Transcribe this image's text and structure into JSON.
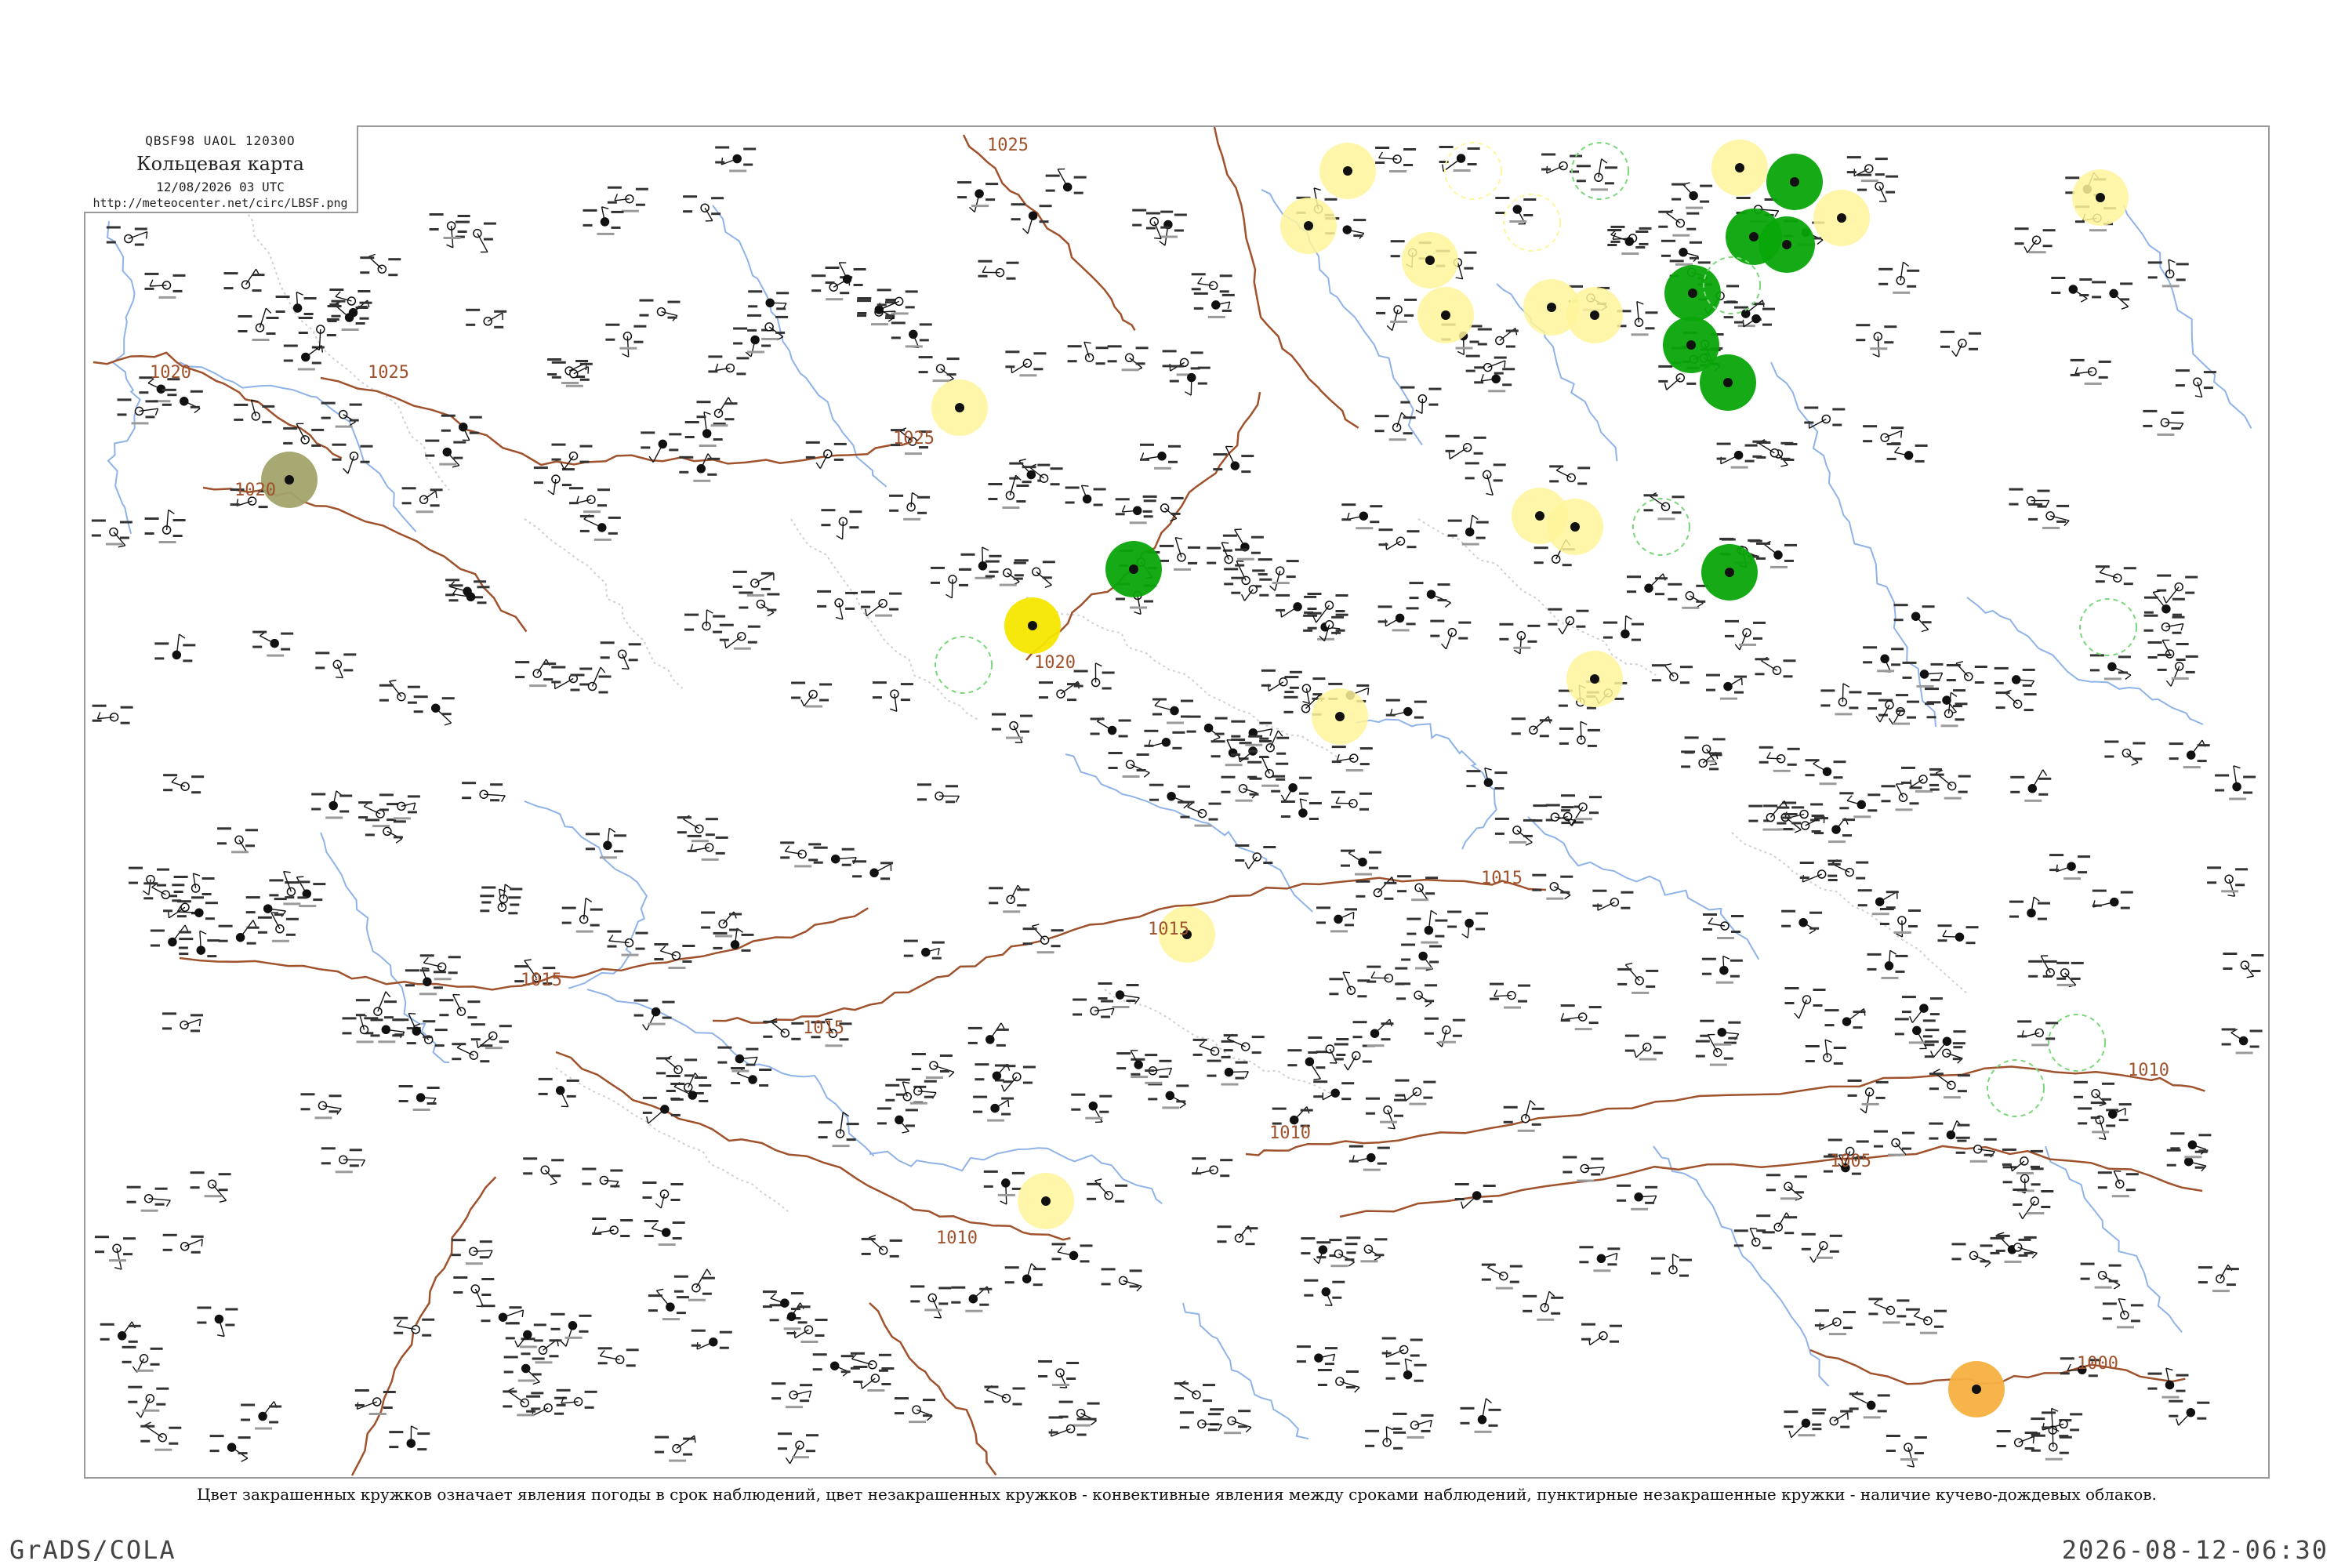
{
  "header": {
    "codes": "QBSF98  UAOL  12030O",
    "title": "Кольцевая карта",
    "datetime": "12/08/2026 03 UTC",
    "url": "http://meteocenter.net/circ/LBSF.png"
  },
  "isobars": [
    "1025",
    "1020",
    "1025",
    "1020",
    "1025",
    "1020",
    "1015",
    "1015",
    "1015",
    "1015",
    "1010",
    "1010",
    "1010",
    "1005",
    "1000"
  ],
  "caption": "Цвет закрашенных кружков означает явления погоды в срок наблюдений, цвет незакрашенных кружков - конвективные явления между сроками наблюдений, пунктирные незакрашенные кружки - наличие кучево-дождевых облаков.",
  "footer": {
    "left": "GrADS/COLA",
    "right": "2026-08-12-06:30"
  },
  "colors": {
    "coast": "#8fb3e8",
    "river": "#8fb3e8",
    "border": "#d0d0d0",
    "isobar": "#a0522d",
    "rain": "#0aa70a",
    "showers": "#7ad77a",
    "haze": "#fff59a",
    "fog": "#f6e600",
    "dust": "#f5b041",
    "mist": "#a3a36b"
  },
  "icons": [
    "station-circle-icon"
  ]
}
